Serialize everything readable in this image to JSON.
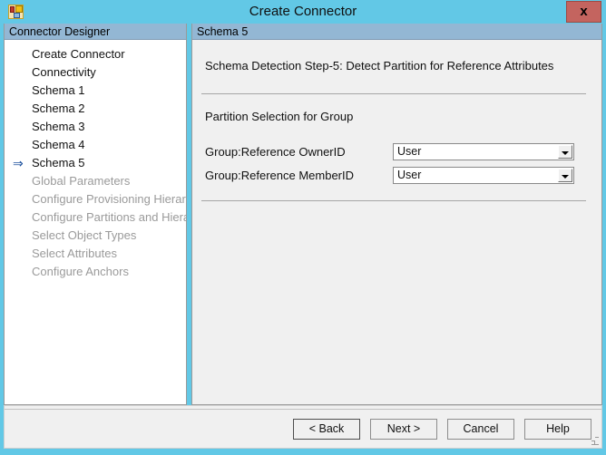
{
  "window": {
    "title": "Create Connector",
    "app_icon": "connector-designer-icon",
    "close_label": "x"
  },
  "sidebar": {
    "header": "Connector Designer",
    "current_arrow": "⇒",
    "items": [
      {
        "label": "Create Connector",
        "enabled": true,
        "current": false
      },
      {
        "label": "Connectivity",
        "enabled": true,
        "current": false
      },
      {
        "label": "Schema 1",
        "enabled": true,
        "current": false
      },
      {
        "label": "Schema 2",
        "enabled": true,
        "current": false
      },
      {
        "label": "Schema 3",
        "enabled": true,
        "current": false
      },
      {
        "label": "Schema 4",
        "enabled": true,
        "current": false
      },
      {
        "label": "Schema 5",
        "enabled": true,
        "current": true
      },
      {
        "label": "Global Parameters",
        "enabled": false,
        "current": false
      },
      {
        "label": "Configure Provisioning Hierarchy",
        "enabled": false,
        "current": false
      },
      {
        "label": "Configure Partitions and Hierarchies",
        "enabled": false,
        "current": false
      },
      {
        "label": "Select Object Types",
        "enabled": false,
        "current": false
      },
      {
        "label": "Select Attributes",
        "enabled": false,
        "current": false
      },
      {
        "label": "Configure Anchors",
        "enabled": false,
        "current": false
      }
    ]
  },
  "content": {
    "header": "Schema 5",
    "step_title": "Schema Detection Step-5: Detect Partition for Reference Attributes",
    "group_label": "Partition Selection for Group",
    "fields": [
      {
        "label": "Group:Reference OwnerID",
        "value": "User"
      },
      {
        "label": "Group:Reference MemberID",
        "value": "User"
      }
    ]
  },
  "footer": {
    "buttons": [
      {
        "label": "< Back",
        "focused": true
      },
      {
        "label": "Next  >",
        "focused": false
      },
      {
        "label": "Cancel",
        "focused": false
      },
      {
        "label": "Help",
        "focused": false
      }
    ]
  },
  "colors": {
    "titlebar": "#62c8e6",
    "pane_header": "#93b7d4",
    "close_button": "#c4645f",
    "content_bg": "#f0f0f0",
    "sidebar_bg": "#ffffff",
    "arrow": "#1a4f9c",
    "disabled_text": "#9a9a9a"
  }
}
